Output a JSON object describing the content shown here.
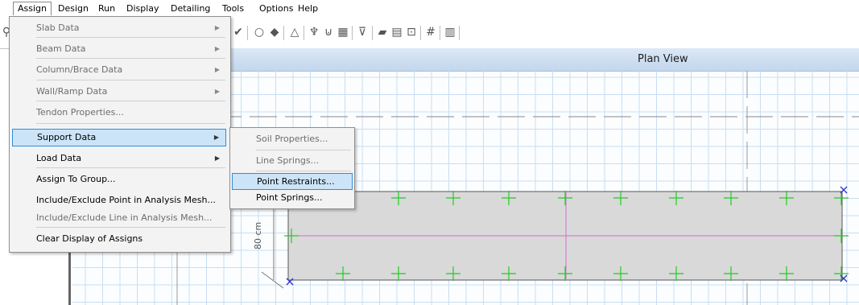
{
  "menubar": [
    "Assign",
    "Design",
    "Run",
    "Display",
    "Detailing",
    "Tools",
    "Options",
    "Help"
  ],
  "view": {
    "title": "Plan View",
    "dimension_label": "80 cm"
  },
  "assign_menu": {
    "items": [
      {
        "label": "Slab Data",
        "disabled": true,
        "submenu": true
      },
      {
        "label": "Beam Data",
        "disabled": true,
        "submenu": true
      },
      {
        "label": "Column/Brace Data",
        "disabled": true,
        "submenu": true
      },
      {
        "label": "Wall/Ramp Data",
        "disabled": true,
        "submenu": true
      },
      {
        "label": "Tendon Properties...",
        "disabled": true,
        "submenu": false
      },
      {
        "label": "Support Data",
        "disabled": false,
        "submenu": true,
        "highlighted": true
      },
      {
        "label": "Load Data",
        "disabled": false,
        "submenu": true
      },
      {
        "label": "Assign To Group...",
        "disabled": false,
        "submenu": false
      },
      {
        "label": "Include/Exclude Point in Analysis Mesh...",
        "disabled": false,
        "submenu": false
      },
      {
        "label": "Include/Exclude Line in Analysis Mesh...",
        "disabled": true,
        "submenu": false
      },
      {
        "label": "Clear Display of Assigns",
        "disabled": false,
        "submenu": false
      }
    ]
  },
  "support_submenu": {
    "items": [
      {
        "label": "Soil Properties...",
        "disabled": true
      },
      {
        "label": "Line Springs...",
        "disabled": true
      },
      {
        "label": "Point Restraints...",
        "disabled": false,
        "highlighted": true
      },
      {
        "label": "Point Springs...",
        "disabled": false
      }
    ]
  },
  "colors": {
    "highlight_bg": "#cce4f7",
    "highlight_border": "#2f8dd9",
    "grid": "#c9def2",
    "slab": "#d9d9d9",
    "mesh_point": "#22cc22",
    "restraint": "#3333cc"
  }
}
